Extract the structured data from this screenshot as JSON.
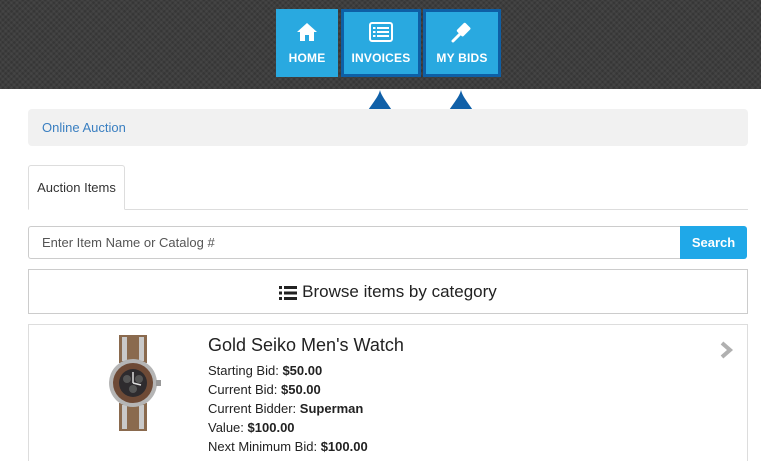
{
  "nav": {
    "home_label": "HOME",
    "invoices_label": "INVOICES",
    "mybids_label": "MY BIDS"
  },
  "icons": {
    "home": "home-icon",
    "invoices": "invoice-icon",
    "mybids": "gavel-icon",
    "pin": "tap-hand-icon",
    "list": "list-icon",
    "chevron": "chevron-right-icon"
  },
  "colors": {
    "nav_button": "#29a9e0",
    "highlight_border": "#0e5fa5",
    "pin": "#1060a8",
    "link": "#3a7fc1",
    "search_button": "#1fa8e8"
  },
  "breadcrumb": {
    "label": "Online Auction"
  },
  "tabs": [
    {
      "label": "Auction Items"
    }
  ],
  "search": {
    "placeholder": "Enter Item Name or Catalog #",
    "button_label": "Search"
  },
  "browse": {
    "label": "Browse items by category"
  },
  "item": {
    "title": "Gold Seiko Men's Watch",
    "starting_bid_label": "Starting Bid:",
    "starting_bid": "$50.00",
    "current_bid_label": "Current Bid:",
    "current_bid": "$50.00",
    "current_bidder_label": "Current Bidder:",
    "current_bidder": "Superman",
    "value_label": "Value:",
    "value": "$100.00",
    "next_min_label": "Next Minimum Bid:",
    "next_min": "$100.00"
  }
}
